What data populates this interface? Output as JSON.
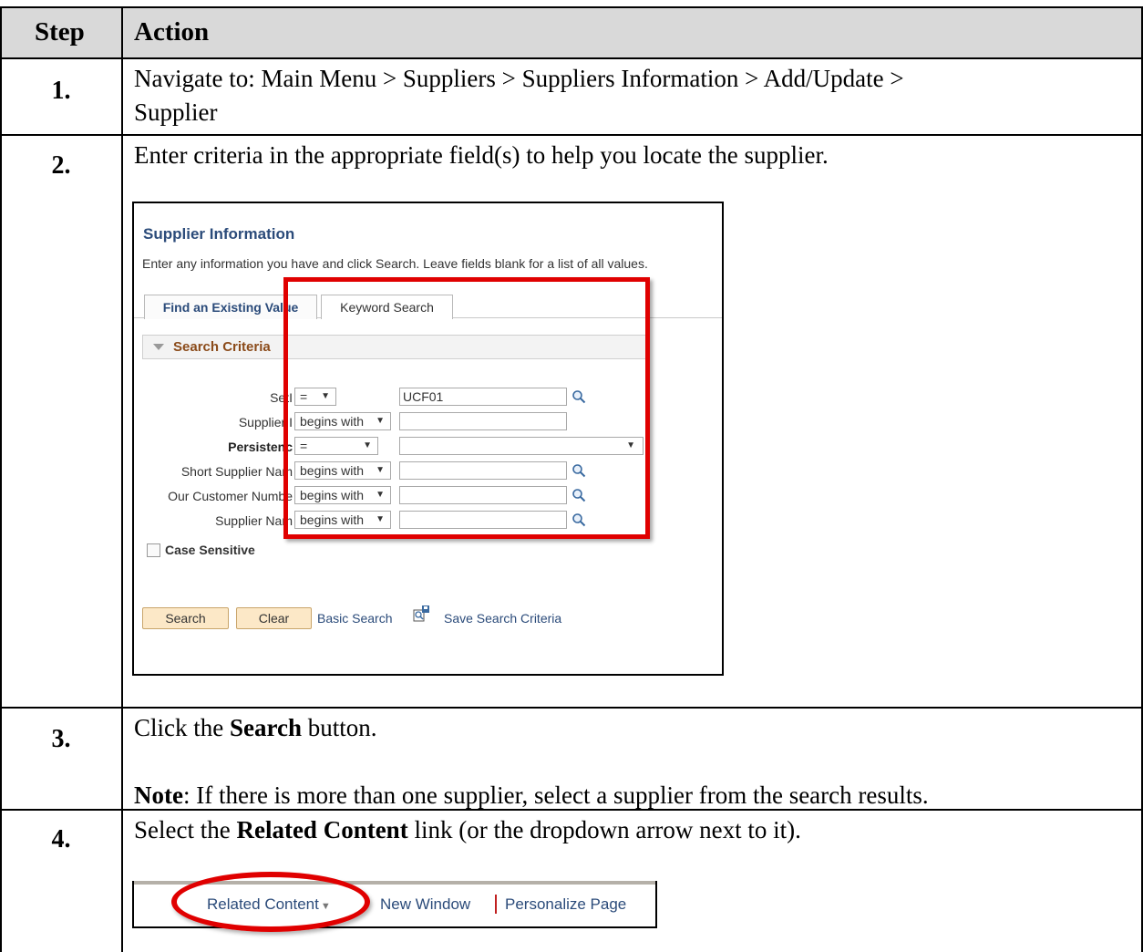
{
  "table": {
    "header_step": "Step",
    "header_action": "Action"
  },
  "steps": [
    {
      "number": "1.",
      "line1": "Navigate to: Main Menu > Suppliers > Suppliers Information > Add/Update >",
      "line2": "Supplier"
    },
    {
      "number": "2.",
      "text": "Enter criteria in the appropriate field(s) to help you locate the supplier."
    },
    {
      "number": "3.",
      "pre": "Click the ",
      "bold": "Search",
      "post": " button.",
      "note_bold": "Note",
      "note_text": ": If there is more than one supplier, select a supplier from the search results."
    },
    {
      "number": "4.",
      "pre": "Select the ",
      "bold": "Related Content",
      "post": " link (or the dropdown arrow next to it)."
    }
  ],
  "supplier_search": {
    "title": "Supplier Information",
    "instructions": "Enter any information you have and click Search. Leave fields blank for a list of all values.",
    "tabs": [
      {
        "label": "Find an Existing Value",
        "active": true
      },
      {
        "label": "Keyword Search",
        "active": false
      }
    ],
    "section_label": "Search Criteria",
    "fields": [
      {
        "label": "SetID",
        "visible_label": "SetI",
        "operator": "=",
        "value": "UCF01",
        "bold": false
      },
      {
        "label": "Supplier ID",
        "visible_label": "Supplier I",
        "operator": "begins with",
        "value": "",
        "bold": false
      },
      {
        "label": "Persistence",
        "visible_label": "Persistenc",
        "operator": "=",
        "value": "",
        "bold": true
      },
      {
        "label": "Short Supplier Name",
        "visible_label": "Short Supplier Nam",
        "operator": "begins with",
        "value": "",
        "bold": false
      },
      {
        "label": "Our Customer Number",
        "visible_label": "Our Customer Numbe",
        "operator": "begins with",
        "value": "",
        "bold": false
      },
      {
        "label": "Supplier Name",
        "visible_label": "Supplier Nam",
        "operator": "begins with",
        "value": "",
        "bold": false
      }
    ],
    "case_sensitive_label": "Case Sensitive",
    "search_button": "Search",
    "clear_button": "Clear",
    "basic_search_link": "Basic Search",
    "save_criteria_link": "Save Search Criteria",
    "highlight_color": "#e00000"
  },
  "page_links": {
    "related_content": "Related Content",
    "new_window": "New Window",
    "personalize_page": "Personalize Page"
  }
}
